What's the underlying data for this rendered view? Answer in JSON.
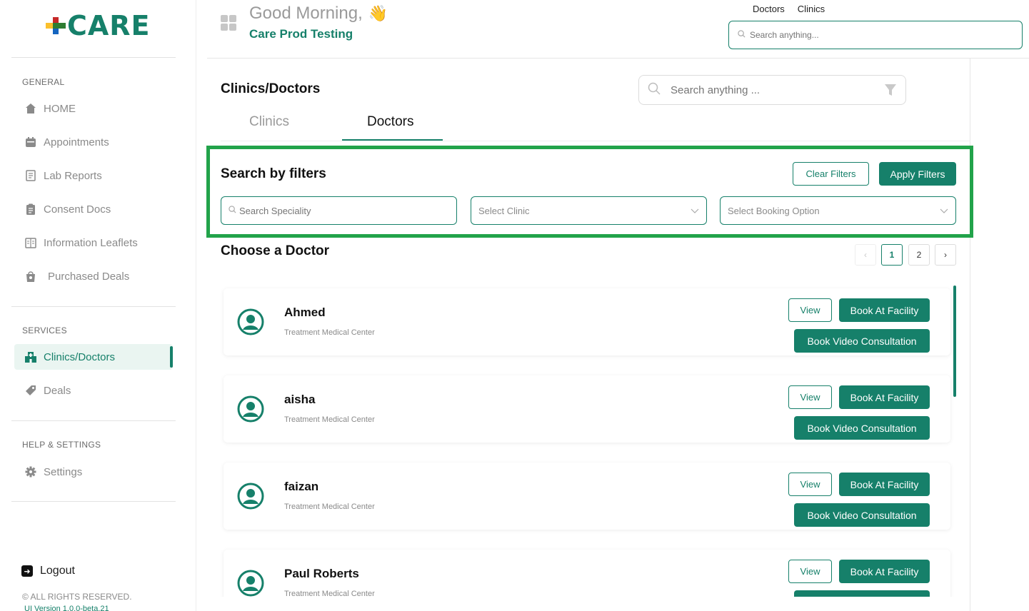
{
  "brand": {
    "name": "CARE"
  },
  "sidebar": {
    "sections": {
      "general": "GENERAL",
      "services": "SERVICES",
      "help": "HELP & SETTINGS"
    },
    "items": [
      {
        "label": "HOME",
        "icon": "home-icon"
      },
      {
        "label": "Appointments",
        "icon": "calendar-icon"
      },
      {
        "label": "Lab Reports",
        "icon": "lab-report-icon"
      },
      {
        "label": "Consent Docs",
        "icon": "clipboard-icon"
      },
      {
        "label": "Information Leaflets",
        "icon": "leaflet-icon"
      },
      {
        "label": "Purchased Deals",
        "icon": "deal-bag-icon"
      },
      {
        "label": "Clinics/Doctors",
        "icon": "hospital-icon",
        "active": true
      },
      {
        "label": "Deals",
        "icon": "tag-icon"
      },
      {
        "label": "Settings",
        "icon": "gear-icon"
      }
    ],
    "logout": "Logout",
    "rights": "© ALL RIGHTS RESERVED.",
    "version": "UI Version 1.0.0-beta.21"
  },
  "header": {
    "greeting": "Good Morning,",
    "greeting_emoji": "👋",
    "org": "Care Prod Testing",
    "links": [
      "Doctors",
      "Clinics"
    ],
    "search_placeholder": "Search anything..."
  },
  "main": {
    "title": "Clinics/Doctors",
    "search_placeholder": "Search anything ...",
    "tabs": [
      {
        "label": "Clinics",
        "active": false
      },
      {
        "label": "Doctors",
        "active": true
      }
    ],
    "filters": {
      "title": "Search by filters",
      "clear_label": "Clear Filters",
      "apply_label": "Apply Filters",
      "speciality_placeholder": "Search Speciality",
      "clinic_placeholder": "Select Clinic",
      "booking_placeholder": "Select Booking Option"
    },
    "choose_title": "Choose a Doctor",
    "pagination": {
      "prev": "‹",
      "pages": [
        "1",
        "2"
      ],
      "current": "1",
      "next": "›"
    },
    "buttons": {
      "view": "View",
      "facility": "Book At Facility",
      "video": "Book Video Consultation"
    },
    "doctors": [
      {
        "name": "Ahmed",
        "clinic": "Treatment Medical Center"
      },
      {
        "name": "aisha",
        "clinic": "Treatment Medical Center"
      },
      {
        "name": "faizan",
        "clinic": "Treatment Medical Center"
      },
      {
        "name": "Paul Roberts",
        "clinic": "Treatment Medical Center"
      }
    ]
  },
  "colors": {
    "brand": "#16806a",
    "highlight_border": "#22a34a"
  }
}
